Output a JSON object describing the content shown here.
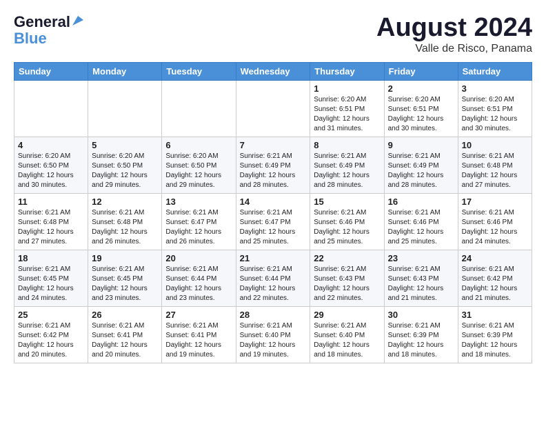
{
  "header": {
    "logo_line1": "General",
    "logo_line2": "Blue",
    "month_year": "August 2024",
    "location": "Valle de Risco, Panama"
  },
  "weekdays": [
    "Sunday",
    "Monday",
    "Tuesday",
    "Wednesday",
    "Thursday",
    "Friday",
    "Saturday"
  ],
  "weeks": [
    [
      {
        "day": "",
        "info": ""
      },
      {
        "day": "",
        "info": ""
      },
      {
        "day": "",
        "info": ""
      },
      {
        "day": "",
        "info": ""
      },
      {
        "day": "1",
        "info": "Sunrise: 6:20 AM\nSunset: 6:51 PM\nDaylight: 12 hours\nand 31 minutes."
      },
      {
        "day": "2",
        "info": "Sunrise: 6:20 AM\nSunset: 6:51 PM\nDaylight: 12 hours\nand 30 minutes."
      },
      {
        "day": "3",
        "info": "Sunrise: 6:20 AM\nSunset: 6:51 PM\nDaylight: 12 hours\nand 30 minutes."
      }
    ],
    [
      {
        "day": "4",
        "info": "Sunrise: 6:20 AM\nSunset: 6:50 PM\nDaylight: 12 hours\nand 30 minutes."
      },
      {
        "day": "5",
        "info": "Sunrise: 6:20 AM\nSunset: 6:50 PM\nDaylight: 12 hours\nand 29 minutes."
      },
      {
        "day": "6",
        "info": "Sunrise: 6:20 AM\nSunset: 6:50 PM\nDaylight: 12 hours\nand 29 minutes."
      },
      {
        "day": "7",
        "info": "Sunrise: 6:21 AM\nSunset: 6:49 PM\nDaylight: 12 hours\nand 28 minutes."
      },
      {
        "day": "8",
        "info": "Sunrise: 6:21 AM\nSunset: 6:49 PM\nDaylight: 12 hours\nand 28 minutes."
      },
      {
        "day": "9",
        "info": "Sunrise: 6:21 AM\nSunset: 6:49 PM\nDaylight: 12 hours\nand 28 minutes."
      },
      {
        "day": "10",
        "info": "Sunrise: 6:21 AM\nSunset: 6:48 PM\nDaylight: 12 hours\nand 27 minutes."
      }
    ],
    [
      {
        "day": "11",
        "info": "Sunrise: 6:21 AM\nSunset: 6:48 PM\nDaylight: 12 hours\nand 27 minutes."
      },
      {
        "day": "12",
        "info": "Sunrise: 6:21 AM\nSunset: 6:48 PM\nDaylight: 12 hours\nand 26 minutes."
      },
      {
        "day": "13",
        "info": "Sunrise: 6:21 AM\nSunset: 6:47 PM\nDaylight: 12 hours\nand 26 minutes."
      },
      {
        "day": "14",
        "info": "Sunrise: 6:21 AM\nSunset: 6:47 PM\nDaylight: 12 hours\nand 25 minutes."
      },
      {
        "day": "15",
        "info": "Sunrise: 6:21 AM\nSunset: 6:46 PM\nDaylight: 12 hours\nand 25 minutes."
      },
      {
        "day": "16",
        "info": "Sunrise: 6:21 AM\nSunset: 6:46 PM\nDaylight: 12 hours\nand 25 minutes."
      },
      {
        "day": "17",
        "info": "Sunrise: 6:21 AM\nSunset: 6:46 PM\nDaylight: 12 hours\nand 24 minutes."
      }
    ],
    [
      {
        "day": "18",
        "info": "Sunrise: 6:21 AM\nSunset: 6:45 PM\nDaylight: 12 hours\nand 24 minutes."
      },
      {
        "day": "19",
        "info": "Sunrise: 6:21 AM\nSunset: 6:45 PM\nDaylight: 12 hours\nand 23 minutes."
      },
      {
        "day": "20",
        "info": "Sunrise: 6:21 AM\nSunset: 6:44 PM\nDaylight: 12 hours\nand 23 minutes."
      },
      {
        "day": "21",
        "info": "Sunrise: 6:21 AM\nSunset: 6:44 PM\nDaylight: 12 hours\nand 22 minutes."
      },
      {
        "day": "22",
        "info": "Sunrise: 6:21 AM\nSunset: 6:43 PM\nDaylight: 12 hours\nand 22 minutes."
      },
      {
        "day": "23",
        "info": "Sunrise: 6:21 AM\nSunset: 6:43 PM\nDaylight: 12 hours\nand 21 minutes."
      },
      {
        "day": "24",
        "info": "Sunrise: 6:21 AM\nSunset: 6:42 PM\nDaylight: 12 hours\nand 21 minutes."
      }
    ],
    [
      {
        "day": "25",
        "info": "Sunrise: 6:21 AM\nSunset: 6:42 PM\nDaylight: 12 hours\nand 20 minutes."
      },
      {
        "day": "26",
        "info": "Sunrise: 6:21 AM\nSunset: 6:41 PM\nDaylight: 12 hours\nand 20 minutes."
      },
      {
        "day": "27",
        "info": "Sunrise: 6:21 AM\nSunset: 6:41 PM\nDaylight: 12 hours\nand 19 minutes."
      },
      {
        "day": "28",
        "info": "Sunrise: 6:21 AM\nSunset: 6:40 PM\nDaylight: 12 hours\nand 19 minutes."
      },
      {
        "day": "29",
        "info": "Sunrise: 6:21 AM\nSunset: 6:40 PM\nDaylight: 12 hours\nand 18 minutes."
      },
      {
        "day": "30",
        "info": "Sunrise: 6:21 AM\nSunset: 6:39 PM\nDaylight: 12 hours\nand 18 minutes."
      },
      {
        "day": "31",
        "info": "Sunrise: 6:21 AM\nSunset: 6:39 PM\nDaylight: 12 hours\nand 18 minutes."
      }
    ]
  ]
}
